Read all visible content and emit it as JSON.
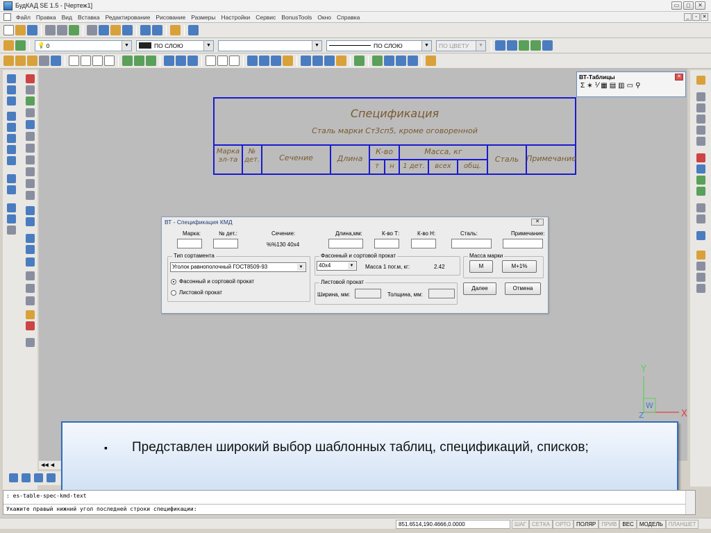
{
  "window": {
    "title": "БудКАД SE 1.5 - [Чертеж1]",
    "controls": [
      "▭",
      "◻",
      "✕"
    ]
  },
  "menu": [
    "Файл",
    "Правка",
    "Вид",
    "Вставка",
    "Редактирование",
    "Рисование",
    "Размеры",
    "Настройки",
    "Сервис",
    "BonusTools",
    "Окно",
    "Справка"
  ],
  "mdi_controls": [
    "_",
    "▫",
    "✕"
  ],
  "props": {
    "layer": "0",
    "color": "ПО СЛОЮ",
    "linetype": "ПО СЛОЮ",
    "lineweight": "ПО ЦВЕТУ"
  },
  "spec_table": {
    "title": "Спецификация",
    "subtitle": "Сталь марки Ст3сп5, кроме оговоренной",
    "h_mark": "Марка эл-та",
    "h_num": "№ дет.",
    "h_section": "Сечение",
    "h_length": "Длина",
    "h_qty": "К-во",
    "h_qty_t": "т",
    "h_qty_n": "н",
    "h_mass": "Масса, кг",
    "h_mass_1": "1 дет.",
    "h_mass_all": "всех",
    "h_mass_total": "общ.",
    "h_steel": "Сталь",
    "h_note": "Примечание"
  },
  "vt_panel": {
    "title": "ВТ-Таблицы",
    "icons": [
      "Σ",
      "∗",
      "⅟",
      "▦",
      "▤",
      "▥",
      "▭",
      "⚲"
    ]
  },
  "dialog": {
    "title": "ВТ - Спецификация КМД",
    "close": "✕",
    "lbl_mark": "Марка:",
    "lbl_num": "№ дет.:",
    "lbl_section": "Сечение:",
    "section_value": "%%130 40x4",
    "lbl_length": "Длина,мм:",
    "lbl_qty_t": "К-во Т:",
    "lbl_qty_n": "К-во Н:",
    "lbl_steel": "Сталь:",
    "lbl_note": "Примечание:",
    "grp_type": "Тип сортамента",
    "type_select": "Уголок равнополочный ГОСТ8509-93",
    "radio_1": "Фасонный и сортовой прокат",
    "radio_2": "Листовой прокат",
    "grp_shaped": "Фасонный и сортовой прокат",
    "size_select": "40x4",
    "lbl_mass_per_m": "Масса 1 пог.м, кг:",
    "mass_per_m": "2.42",
    "grp_mass": "Масса марки",
    "btn_m": "М",
    "btn_m1": "М+1%",
    "grp_sheet": "Листовой прокат",
    "lbl_width": "Ширина, мм:",
    "lbl_thickness": "Толщина, мм:",
    "btn_next": "Далее",
    "btn_cancel": "Отмена"
  },
  "banner": {
    "bullet": "▪",
    "text": "Представлен широкий выбор шаблонных таблиц, спецификаций, списков;"
  },
  "command": {
    "line1": ": es-table-spec-kmd-text",
    "line2": "Укажите правый нижний угол последней строки спецификации:"
  },
  "status": {
    "coords": "851.6514,190.4666,0.0000",
    "buttons": [
      {
        "label": "ШАГ",
        "on": false
      },
      {
        "label": "СЕТКА",
        "on": false
      },
      {
        "label": "ОРТО",
        "on": false
      },
      {
        "label": "ПОЛЯР",
        "on": true
      },
      {
        "label": "ПРИВ",
        "on": false
      },
      {
        "label": "ВЕС",
        "on": true
      },
      {
        "label": "МОДЕЛЬ",
        "on": true
      },
      {
        "label": "ПЛАНШЕТ",
        "on": false
      }
    ]
  },
  "ucs": {
    "y": "Y",
    "x": "X",
    "w": "W",
    "z": "Z"
  },
  "nav_arrows": [
    "◀◀",
    "◀"
  ],
  "colors": {
    "table_lines": "#1a1ad0",
    "table_text": "#7a5a30",
    "banner_border": "#2f6dbd",
    "ucs_y": "#5bd05b",
    "ucs_x": "#e04040"
  }
}
